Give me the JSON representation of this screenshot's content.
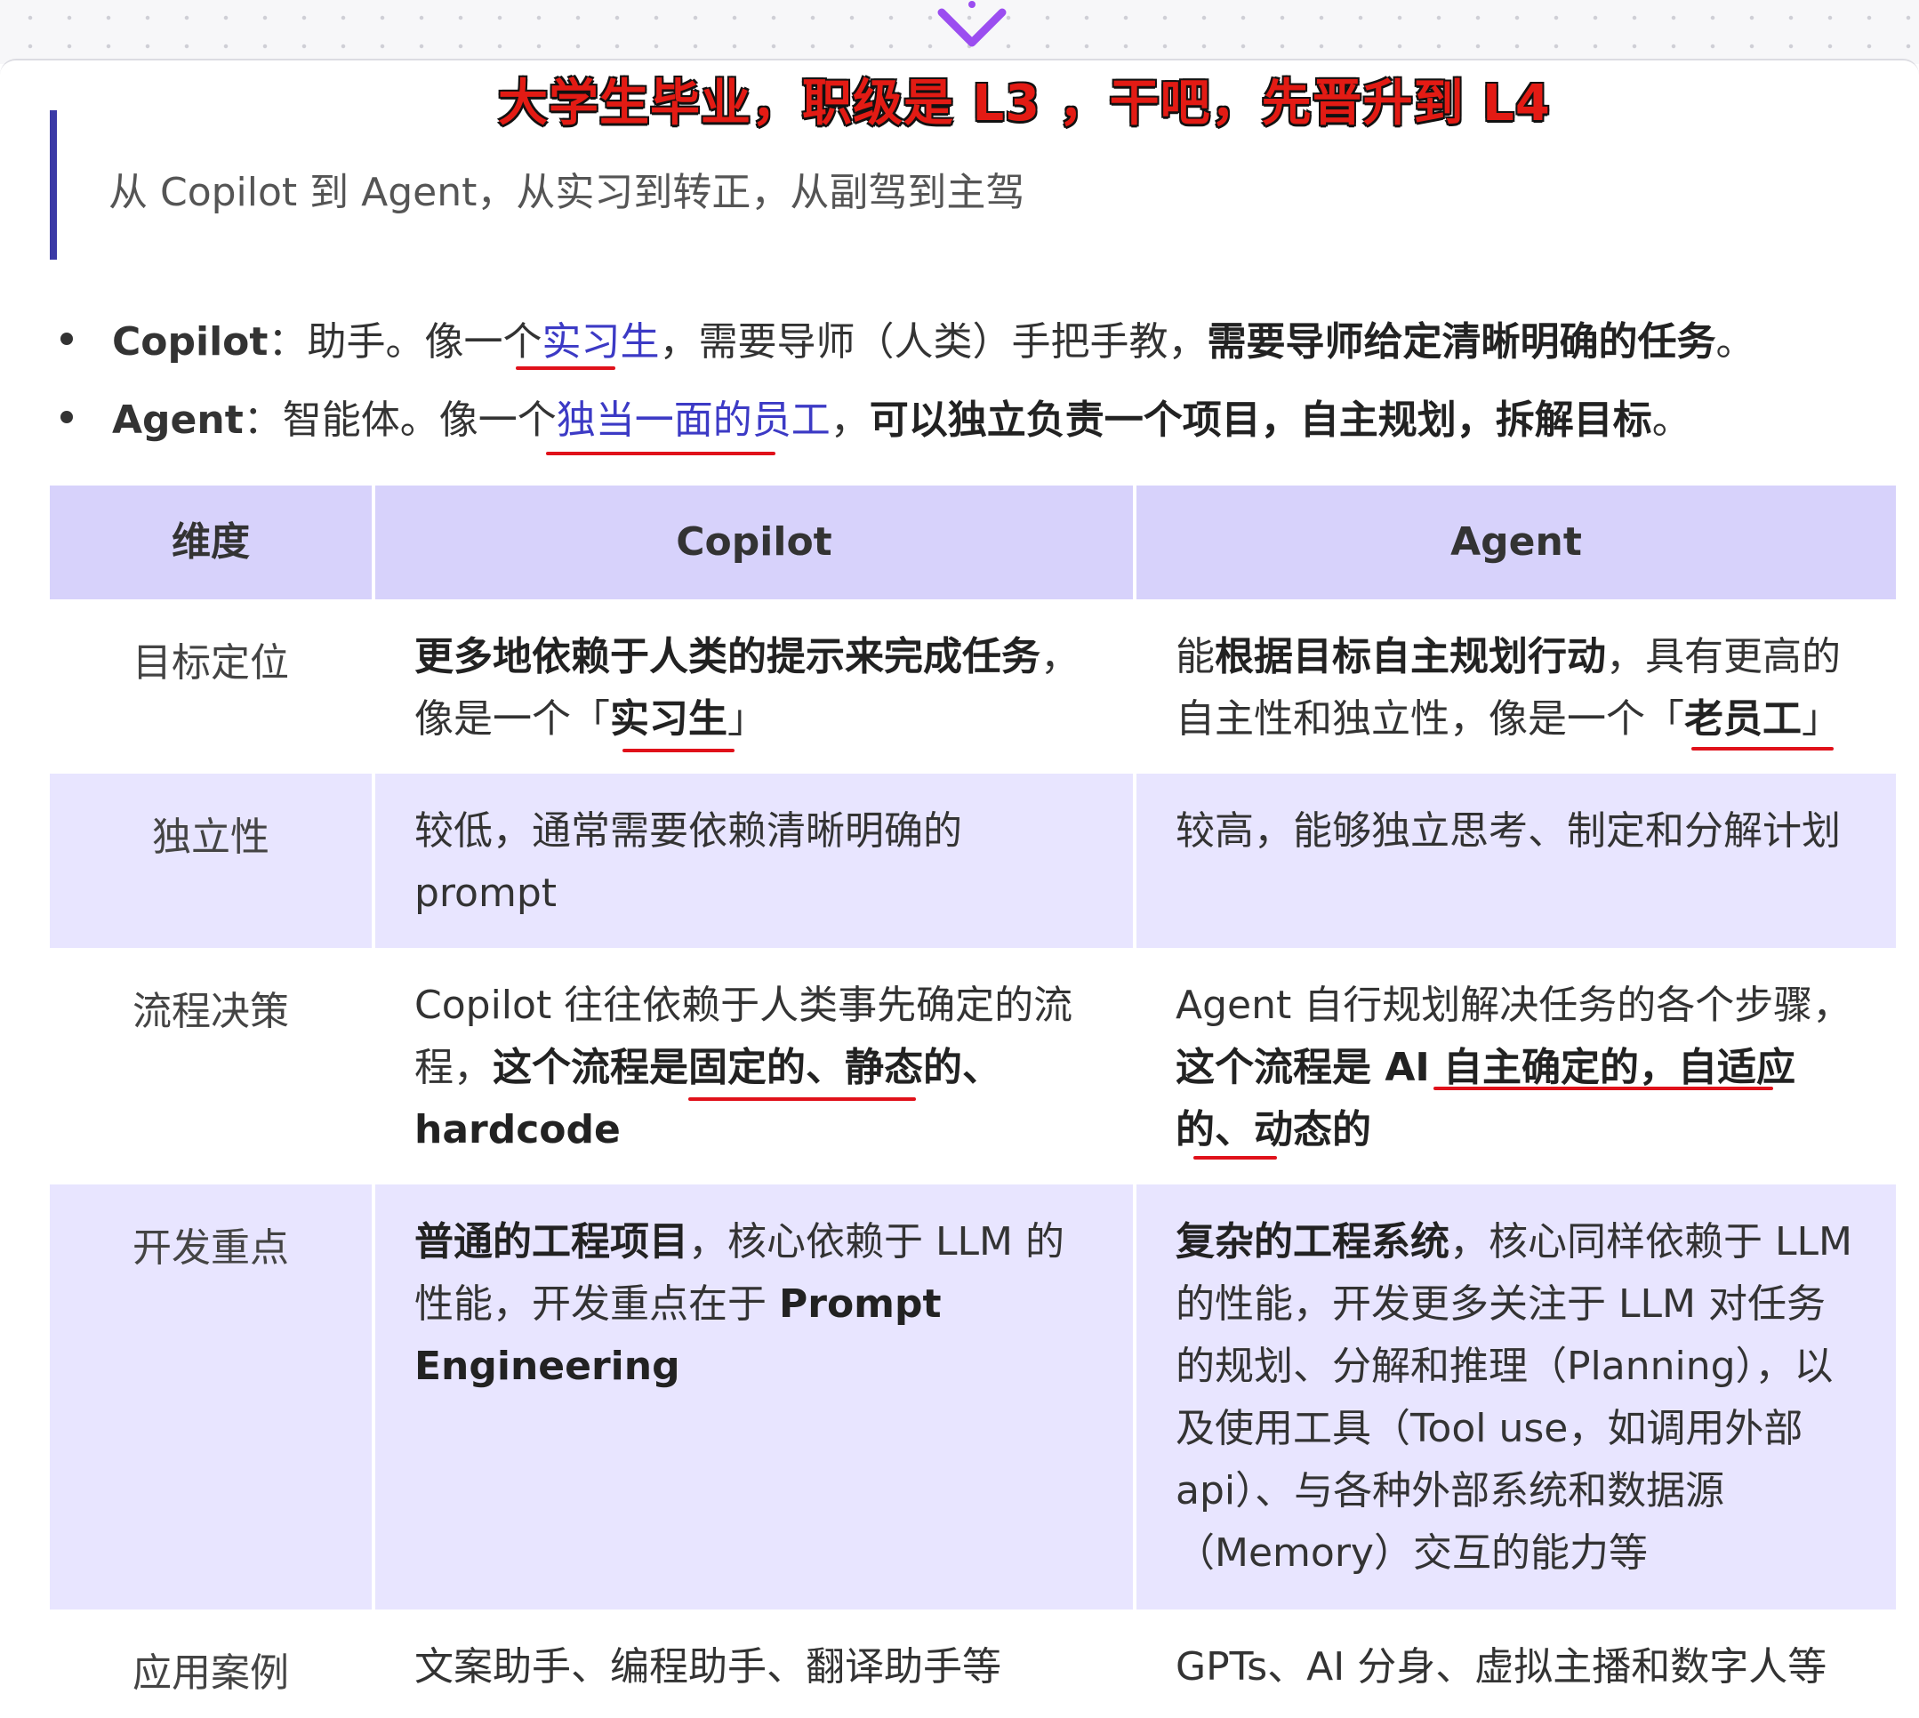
{
  "overlay": {
    "headline": "大学生毕业，职级是 L3 ，干吧，先晋升到 L4"
  },
  "quote": {
    "text": "从 Copilot 到 Agent，从实习到转正，从副驾到主驾"
  },
  "bullets": [
    {
      "term": "Copilot",
      "sep": "：",
      "pre": "助手。像一个",
      "link": "实习生",
      "mid": "，需要导师（人类）手把手教，",
      "bold": "需要导师给定清晰明确的任务",
      "end": "。"
    },
    {
      "term": "Agent",
      "sep": "：",
      "pre": "智能体。像一个",
      "link": "独当一面的员工",
      "mid": "，",
      "bold": "可以独立负责一个项目，自主规划，拆解目标",
      "end": "。"
    }
  ],
  "table": {
    "headers": [
      "维度",
      "Copilot",
      "Agent"
    ],
    "rows": [
      {
        "dim": "目标定位",
        "copilot": {
          "b1": "更多地依赖于人类的提示来完成任务",
          "t1": "，像是一个「",
          "b2": "实习生",
          "t2": "」"
        },
        "agent": {
          "t1": "能",
          "b1": "根据目标自主规划行动",
          "t2": "，具有更高的自主性和独立性，像是一个「",
          "b2": "老员工",
          "t3": "」"
        }
      },
      {
        "dim": "独立性",
        "copilot": {
          "t1": "较低，通常需要依赖清晰明确的 prompt"
        },
        "agent": {
          "t1": "较高，能够独立思考、制定和分解计划"
        }
      },
      {
        "dim": "流程决策",
        "copilot": {
          "t1": "Copilot 往往依赖于人类事先确定的流程，",
          "b1": "这个流程是固定的、静态的、hardcode"
        },
        "agent": {
          "t1": "Agent 自行规划解决任务的各个步骤，",
          "b1": "这个流程是 AI 自主确定的，自适应的、动态的"
        }
      },
      {
        "dim": "开发重点",
        "copilot": {
          "b1": "普通的工程项目",
          "t1": "，核心依赖于 LLM 的性能，开发重点在于 ",
          "b2": "Prompt Engineering"
        },
        "agent": {
          "b1": "复杂的工程系统",
          "t1": "，核心同样依赖于 LLM 的性能，开发更多关注于 LLM 对任务的规划、分解和推理（Planning），以及使用工具（Tool use，如调用外部 api）、与各种外部系统和数据源（Memory）交互的能力等"
        }
      },
      {
        "dim": "应用案例",
        "copilot": {
          "t1": "文案助手、编程助手、翻译助手等"
        },
        "agent": {
          "t1": "GPTs、AI 分身、虚拟主播和数字人等"
        }
      }
    ]
  },
  "colors": {
    "header_bg": "#d7d2fb",
    "shaded_row_bg": "#e8e5ff",
    "link": "#3c3ac5",
    "quote_bar": "#3b3aa6",
    "annotation_red": "#e0111a",
    "chevron": "#9b4df0"
  },
  "icons": {
    "top_arrow": "chevron-down-icon"
  }
}
